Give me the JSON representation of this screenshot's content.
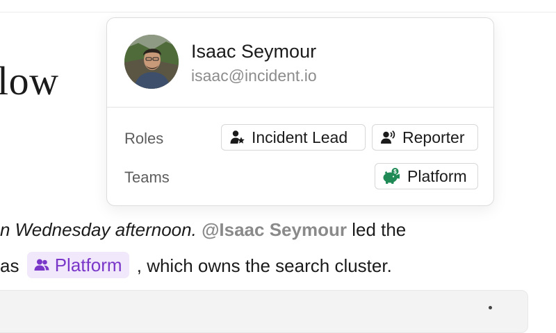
{
  "doc": {
    "heading_fragment": "low",
    "paragraph": {
      "line1_italic": "n Wednesday afternoon.",
      "line1_mention": "@Isaac Seymour",
      "line1_tail": "led the",
      "line2_start": "as",
      "team_chip_label": "Platform",
      "line2_tail": ", which owns the search cluster."
    }
  },
  "popover": {
    "name": "Isaac Seymour",
    "email": "isaac@incident.io",
    "roles_label": "Roles",
    "teams_label": "Teams",
    "roles": [
      {
        "label": "Incident Lead",
        "icon": "user-star-icon"
      },
      {
        "label": "Reporter",
        "icon": "user-speaking-icon"
      }
    ],
    "teams": [
      {
        "label": "Platform",
        "icon": "piggy-bank-icon"
      }
    ]
  },
  "colors": {
    "team_chip_bg": "#f1e9fb",
    "team_chip_text": "#7a36c9",
    "platform_icon": "#1f8a55",
    "mention": "#8a8a8a"
  }
}
